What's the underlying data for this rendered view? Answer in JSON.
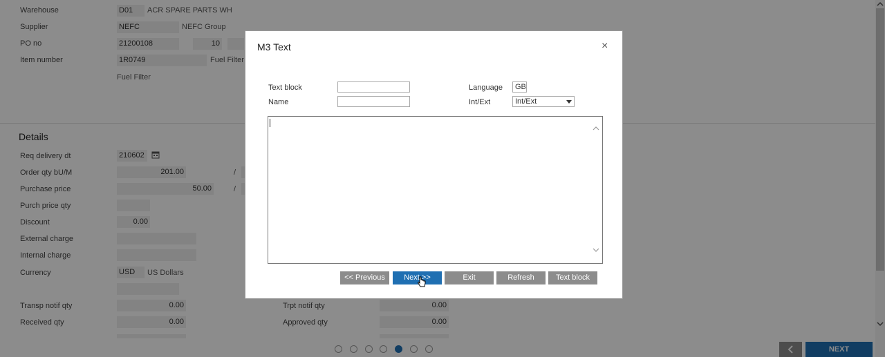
{
  "header": {
    "warehouse": {
      "label": "Warehouse",
      "code": "D01",
      "name": "ACR SPARE PARTS WH"
    },
    "supplier": {
      "label": "Supplier",
      "code": "NEFC",
      "name": "NEFC Group"
    },
    "po": {
      "label": "PO no",
      "number": "21200108",
      "line": "10"
    },
    "item": {
      "label": "Item number",
      "code": "1R0749",
      "name": "Fuel Filter",
      "description": "Fuel Filter"
    }
  },
  "details": {
    "title": "Details",
    "req_delivery": {
      "label": "Req delivery dt",
      "value": "210602"
    },
    "order_qty": {
      "label": "Order qty bU/M",
      "value": "201.00",
      "sep": "/"
    },
    "purchase_price": {
      "label": "Purchase price",
      "value": "50.00",
      "sep": "/"
    },
    "purch_price_qty": {
      "label": "Purch price qty",
      "value": ""
    },
    "discount": {
      "label": "Discount",
      "value": "0.00"
    },
    "external_charge": {
      "label": "External charge",
      "value": ""
    },
    "internal_charge": {
      "label": "Internal charge",
      "value": ""
    },
    "currency": {
      "label": "Currency",
      "code": "USD",
      "name": "US Dollars"
    },
    "transp_notif_qty": {
      "label": "Transp notif qty",
      "value": "0.00"
    },
    "trpt_notif_qty": {
      "label": "Trpt notif qty",
      "value": "0.00"
    },
    "received_qty": {
      "label": "Received qty",
      "value": "0.00"
    },
    "approved_qty": {
      "label": "Approved qty",
      "value": "0.00"
    }
  },
  "pager": {
    "count": 7,
    "active_index": 4
  },
  "footer": {
    "next_label": "NEXT",
    "prev_icon": "chevron-left-icon"
  },
  "modal": {
    "title": "M3 Text",
    "close_symbol": "×",
    "text_block": {
      "label": "Text block",
      "value": ""
    },
    "name": {
      "label": "Name",
      "value": ""
    },
    "language": {
      "label": "Language",
      "value": "GB"
    },
    "int_ext": {
      "label": "Int/Ext",
      "selected": "Int/Ext"
    },
    "text_content": "",
    "buttons": {
      "previous": "<< Previous",
      "next": "Next >>",
      "exit": "Exit",
      "refresh": "Refresh",
      "text_block": "Text block"
    }
  },
  "colors": {
    "accent": "#1f6fb2",
    "button_gray": "#8c8c8c",
    "overlay": "rgba(0,0,0,0.45)"
  }
}
